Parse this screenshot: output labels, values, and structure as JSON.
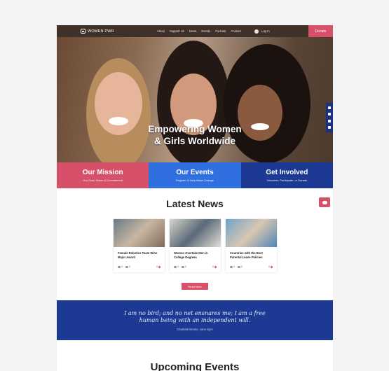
{
  "header": {
    "logo": "WOMEN PWR",
    "nav": [
      "About",
      "Support Us",
      "News",
      "Events",
      "Podcast",
      "Contact"
    ],
    "login": "Log In",
    "donate": "Donate"
  },
  "hero": {
    "title_line1": "Empowering Women",
    "title_line2": "& Girls Worldwide",
    "social_icons": [
      "facebook-icon",
      "twitter-icon",
      "youtube-icon",
      "instagram-icon"
    ]
  },
  "cards": [
    {
      "title": "Our Mission",
      "subtitle": "Our Goal, Vision & Commitment",
      "color": "#d6506a"
    },
    {
      "title": "Our Events",
      "subtitle": "Register & Help Make Change",
      "color": "#2f6fe0"
    },
    {
      "title": "Get Involved",
      "subtitle": "Volunteer, Participate, or Donate",
      "color": "#1c3a94"
    }
  ],
  "news": {
    "title": "Latest News",
    "items": [
      {
        "headline": "Female Robotics Team Wins Major Award",
        "views": "0",
        "comments": "0",
        "likes": "0"
      },
      {
        "headline": "Women Overtake Men in College Degrees",
        "views": "0",
        "comments": "0",
        "likes": "0"
      },
      {
        "headline": "Countries with the Best Parental Leave Policies",
        "views": "0",
        "comments": "0",
        "likes": "0"
      }
    ],
    "read_more": "Read More"
  },
  "quote": {
    "line1": "I am no bird; and no net ensnares me; I am a free",
    "line2": "human being with an independent will.",
    "author": "Charlotte Bronte, Jane Eyre"
  },
  "upcoming": {
    "title": "Upcoming Events"
  }
}
